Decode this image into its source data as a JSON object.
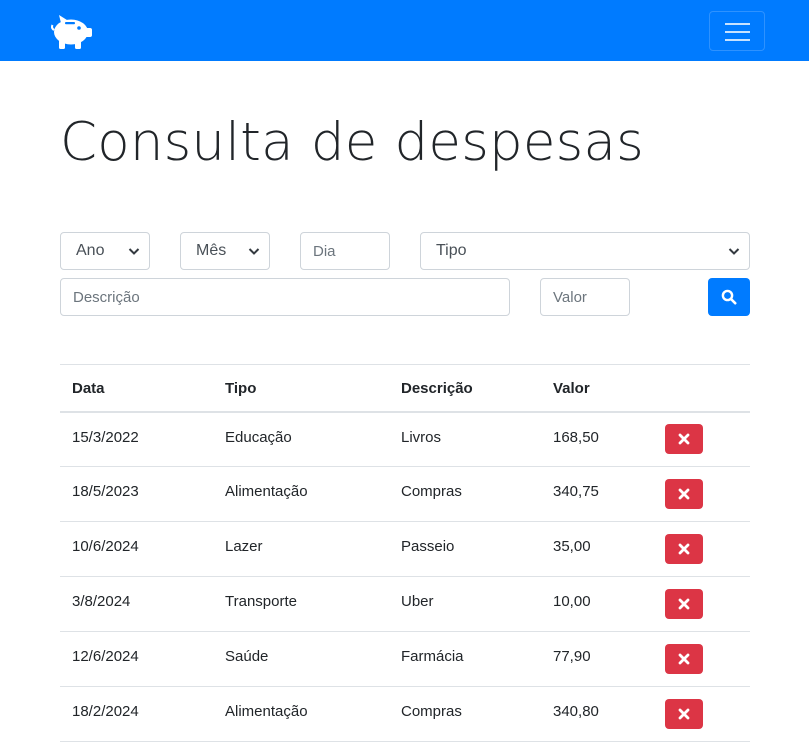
{
  "navbar": {
    "brand_icon": "piggy-bank-icon",
    "menu_icon": "hamburger-menu-icon",
    "color": "#007bff"
  },
  "page_title": "Consulta de despesas",
  "filters": {
    "ano": "Ano",
    "mes": "Mês",
    "dia_placeholder": "Dia",
    "tipo": "Tipo",
    "descricao_placeholder": "Descrição",
    "valor_placeholder": "Valor",
    "search_icon": "search-icon"
  },
  "table": {
    "headers": [
      "Data",
      "Tipo",
      "Descrição",
      "Valor"
    ],
    "rows": [
      {
        "data": "15/3/2022",
        "tipo": "Educação",
        "descricao": "Livros",
        "valor": "168,50"
      },
      {
        "data": "18/5/2023",
        "tipo": "Alimentação",
        "descricao": "Compras",
        "valor": "340,75"
      },
      {
        "data": "10/6/2024",
        "tipo": "Lazer",
        "descricao": "Passeio",
        "valor": "35,00"
      },
      {
        "data": "3/8/2024",
        "tipo": "Transporte",
        "descricao": "Uber",
        "valor": "10,00"
      },
      {
        "data": "12/6/2024",
        "tipo": "Saúde",
        "descricao": "Farmácia",
        "valor": "77,90"
      },
      {
        "data": "18/2/2024",
        "tipo": "Alimentação",
        "descricao": "Compras",
        "valor": "340,80"
      }
    ],
    "delete_icon": "close-icon",
    "delete_color": "#dc3545"
  }
}
